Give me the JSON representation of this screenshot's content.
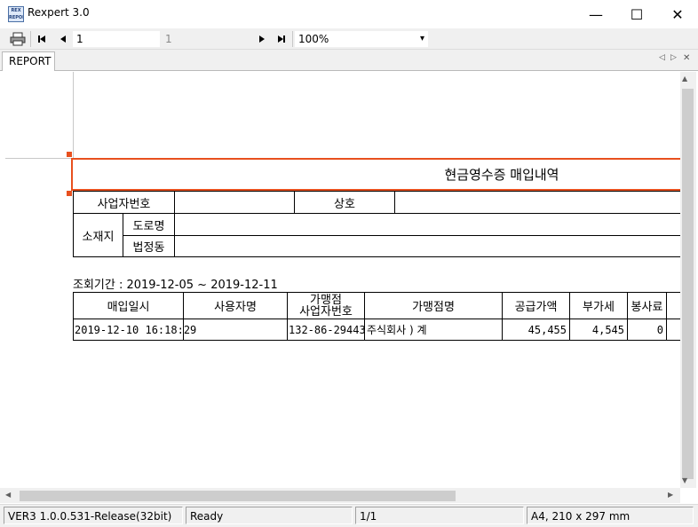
{
  "window": {
    "title": "Rexpert 3.0",
    "icon_text": "REX REPORT",
    "minimize_glyph": "—",
    "maximize_glyph": "☐",
    "close_glyph": "✕"
  },
  "toolbar": {
    "print_icon": "printer-icon",
    "first_glyph": "⏮",
    "prev_glyph": "◀",
    "current_page": "1",
    "total_pages": "1",
    "next_glyph": "▶",
    "last_glyph": "⏭",
    "zoom": "100%",
    "zoom_arrow": "▾"
  },
  "tabs": {
    "active": "REPORT",
    "nav_left": "◁",
    "nav_right": "▷",
    "close": "✕"
  },
  "report": {
    "title": "현금영수증 매입내역",
    "info": {
      "biz_no_label": "사업자번호",
      "company_label": "상호",
      "address_label": "소재지",
      "road_label": "도로명",
      "lot_label": "법정동"
    },
    "period": "조회기간 : 2019-12-05 ~ 2019-12-11",
    "table": {
      "headers": [
        "매입일시",
        "사용자명",
        "가맹점\n사업자번호",
        "가맹점명",
        "공급가액",
        "부가세",
        "봉사료"
      ],
      "rows": [
        [
          "2019-12-10 16:18:29",
          "",
          "132-86-29443",
          "주식회사   )  계",
          "45,455",
          "4,545",
          "0"
        ]
      ]
    }
  },
  "scroll": {
    "up": "▲",
    "down": "▼",
    "left": "◀",
    "right": "▶"
  },
  "status": {
    "version": "VER3 1.0.0.531-Release(32bit)",
    "state": "Ready",
    "page": "1/1",
    "paper": "A4, 210 x 297 mm"
  }
}
